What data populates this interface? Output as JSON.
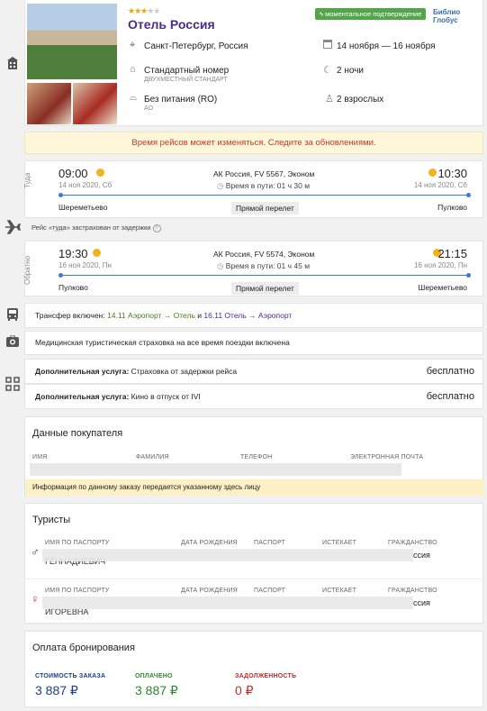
{
  "hotel": {
    "stars_filled": 3,
    "stars_total": 5,
    "name": "Отель Россия",
    "badge": "моментальное подтверждение",
    "operator": "Библио Глобус",
    "city": "Санкт-Петербург, Россия",
    "dates": "14 ноября — 16 ноября",
    "room": "Стандартный номер",
    "room_sub": "ДВУХМЕСТНЫЙ СТАНДАРТ",
    "nights": "2 ночи",
    "meal": "Без питания (RO)",
    "meal_code": "AO",
    "guests": "2 взрослых"
  },
  "notice": "Время рейсов может изменяться. Следите за обновлениями.",
  "flight_out": {
    "dir": "Туда",
    "dep_time": "09:00",
    "dep_date": "14 ноя 2020, Сб",
    "airline": "АК Россия, FV 5567, Эконом",
    "duration": "Время в пути: 01 ч 30 м",
    "arr_time": "10:30",
    "arr_date": "14 ноя 2020, Сб",
    "from": "Шереметьево",
    "type": "Прямой перелет",
    "to": "Пулково",
    "insured": "Рейс «туда» застрахован от задержки"
  },
  "flight_back": {
    "dir": "Обратно",
    "dep_time": "19:30",
    "dep_date": "16 ноя 2020, Пн",
    "airline": "АК Россия, FV 5574, Эконом",
    "duration": "Время в пути: 01 ч 45 м",
    "arr_time": "21:15",
    "arr_date": "16 ноя 2020, Пн",
    "from": "Пулково",
    "type": "Прямой перелет",
    "to": "Шереметьево"
  },
  "transfer": {
    "label": "Трансфер включен:",
    "d1": "14.11",
    "r1": "Аэропорт → Отель",
    "and": "и",
    "d2": "16.11",
    "r2": "Отель → Аэропорт"
  },
  "insurance": "Медицинская туристическая страховка на все время поездки включена",
  "extras": [
    {
      "label": "Дополнительная услуга:",
      "name": "Страховка от задержки рейса",
      "price": "бесплатно"
    },
    {
      "label": "Дополнительная услуга:",
      "name": "Кино в отпуск от IVI",
      "price": "бесплатно"
    }
  ],
  "buyer": {
    "title": "Данные покупателя",
    "cols": [
      "ИМЯ",
      "ФАМИЛИЯ",
      "ТЕЛЕФОН",
      "ЭЛЕКТРОННАЯ ПОЧТА"
    ],
    "info": "Информация по данному заказу передается указанному здесь лицу"
  },
  "tourists": {
    "title": "Туристы",
    "cols": [
      "ИМЯ ПО ПАСПОРТУ",
      "ДАТА РОЖДЕНИЯ",
      "ПАСПОРТ",
      "ИСТЕКАЕТ",
      "ГРАЖДАНСТВО"
    ],
    "rows": [
      {
        "name": "ГЕННАДИЕВИЧ",
        "cit": "ссия"
      },
      {
        "name": "ИГОРЕВНА",
        "cit": "ссия"
      }
    ]
  },
  "payment": {
    "title": "Оплата бронирования",
    "items": [
      {
        "label": "СТОИМОСТЬ ЗАКАЗА",
        "value": "3 887 ₽",
        "color": "#1d3f86"
      },
      {
        "label": "ОПЛАЧЕНО",
        "value": "3 887 ₽",
        "color": "#2a8a2a"
      },
      {
        "label": "ЗАДОЛЖЕННОСТЬ",
        "value": "0 ₽",
        "color": "#c42b2b"
      }
    ]
  },
  "colors": {
    "accent": "#4b2a8c",
    "badge": "#52a548",
    "flight_line": "#3a7bd5",
    "notice": "#c0392b",
    "transfer": "#4b7a1e",
    "info_bg": "#fbf1c4"
  }
}
